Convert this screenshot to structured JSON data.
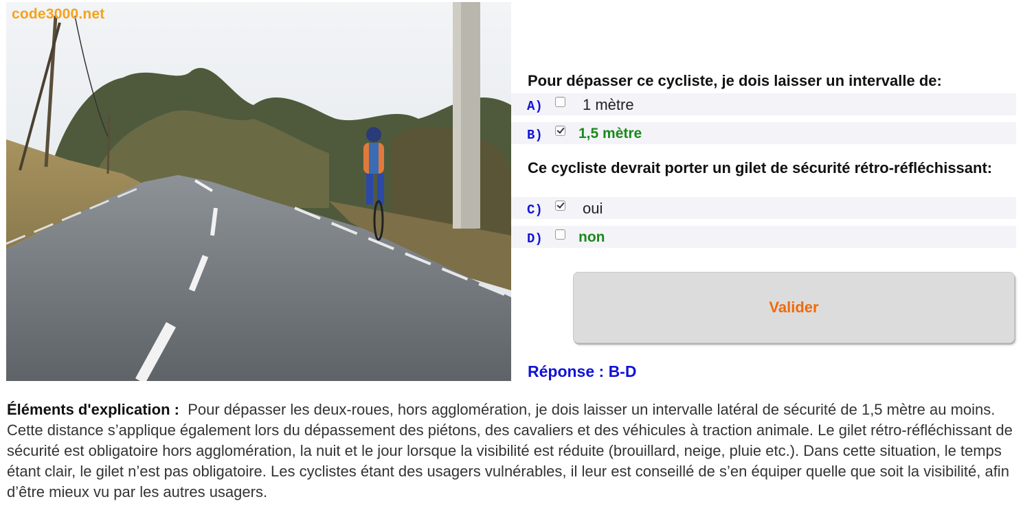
{
  "watermark": "code3000.net",
  "question1": {
    "text": "Pour dépasser ce cycliste, je dois laisser un intervalle de:",
    "answers": [
      {
        "letter": "A)",
        "text": "1 mètre",
        "checked": false
      },
      {
        "letter": "B)",
        "text": "1,5 mètre",
        "checked": true
      }
    ]
  },
  "question2": {
    "text": "Ce cycliste devrait porter un gilet de sécurité rétro-réfléchissant:",
    "answers": [
      {
        "letter": "C)",
        "text": "oui",
        "checked": true
      },
      {
        "letter": "D)",
        "text": "non",
        "checked": false
      }
    ]
  },
  "validate_label": "Valider",
  "response": "Réponse : B-D",
  "explanation": {
    "label": "Éléments d'explication :",
    "text": "Pour dépasser les deux-roues, hors agglomération, je dois laisser un intervalle latéral de sécurité de 1,5 mètre au moins. Cette distance s’applique également lors du dépassement des piétons, des cavaliers et des véhicules à traction animale. Le gilet rétro-réfléchissant de sécurité est obligatoire hors agglomération, la nuit et le jour lorsque la visibilité est réduite (brouillard, neige, pluie etc.). Dans cette situation, le temps étant clair, le gilet n’est pas obligatoire. Les cyclistes étant des usagers vulnérables, il leur est conseillé de s’en équiper quelle que soit la visibilité, afin d’être mieux vu par les autres usagers."
  },
  "colors": {
    "correct": "#1a8a1a",
    "letter": "#1515d6",
    "validate_text": "#f06a0a",
    "response": "#1212d8",
    "watermark": "#f6a21b"
  }
}
